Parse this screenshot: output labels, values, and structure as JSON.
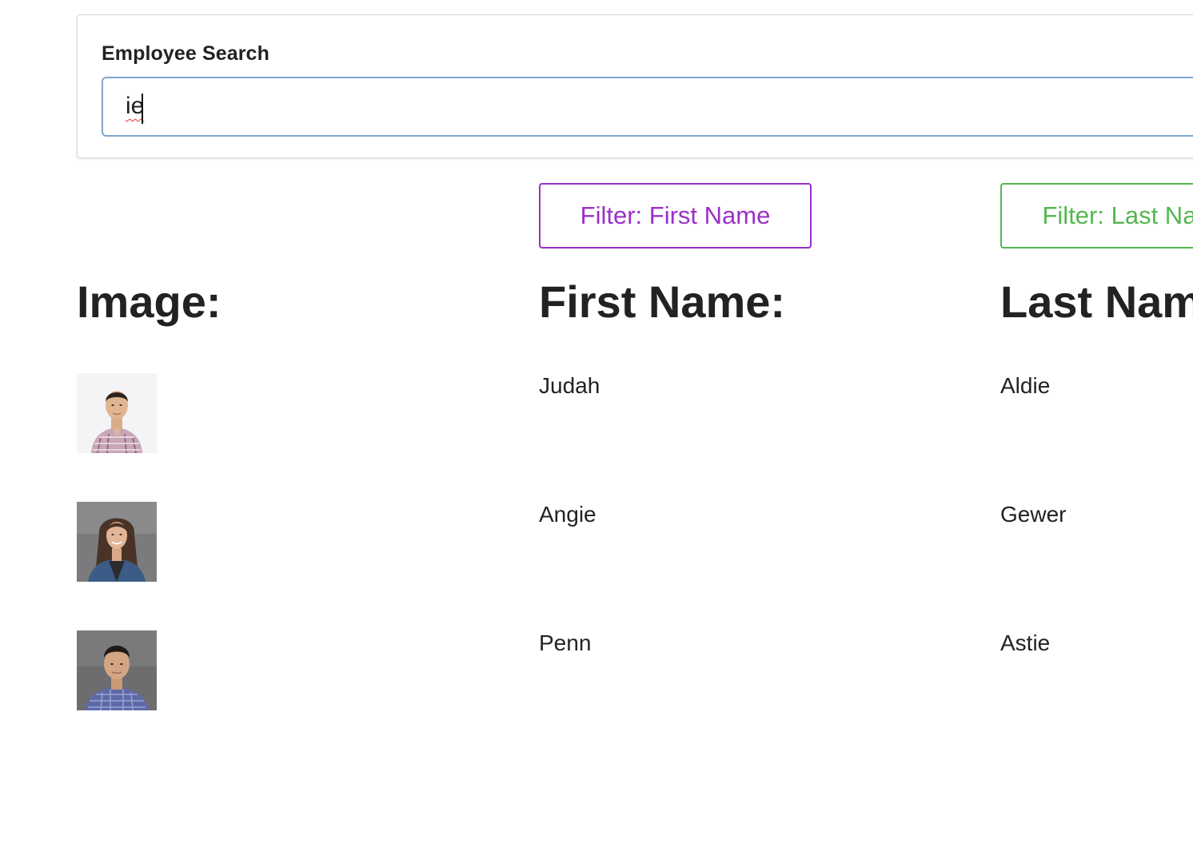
{
  "search": {
    "label": "Employee Search",
    "value": "ie"
  },
  "filters": {
    "first_name_label": "Filter: First Name",
    "last_name_label": "Filter: Last Name",
    "first_color": "#9b30c8",
    "last_color": "#53b84e"
  },
  "columns": {
    "image": "Image:",
    "first_name": "First Name:",
    "last_name": "Last Name:"
  },
  "employees": [
    {
      "first": "Judah",
      "last": "Aldie",
      "photo": "man-short-hair-plaid-shirt-white-bg"
    },
    {
      "first": "Angie",
      "last": "Gewer",
      "photo": "woman-long-hair-blue-jacket-gray-bg"
    },
    {
      "first": "Penn",
      "last": "Astie",
      "photo": "man-dark-hair-blue-check-shirt-gray-bg"
    }
  ]
}
